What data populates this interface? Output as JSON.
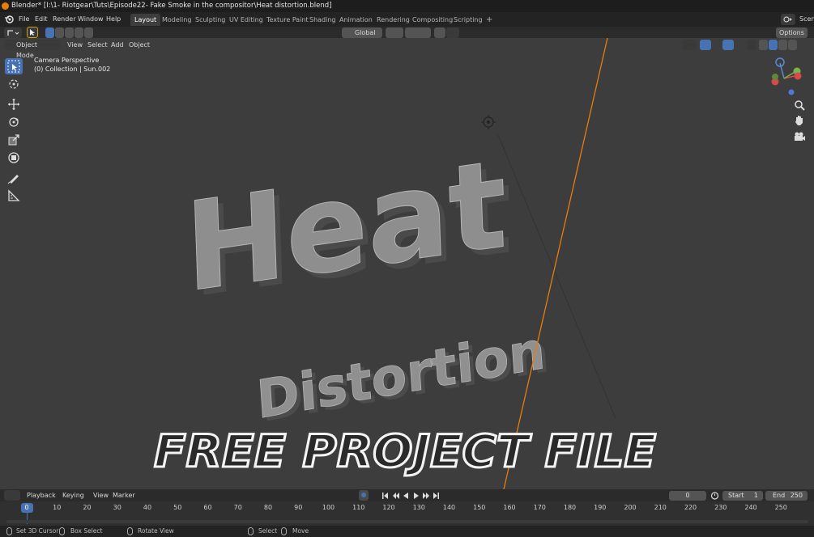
{
  "window": {
    "title": "Blender* [I:\\1- Riotgear\\Tuts\\Episode22- Fake Smoke in the compositor\\Heat distortion.blend]"
  },
  "menu": {
    "items": [
      "File",
      "Edit",
      "Render",
      "Window",
      "Help"
    ]
  },
  "workspaces": {
    "tabs": [
      "Layout",
      "Modeling",
      "Sculpting",
      "UV Editing",
      "Texture Paint",
      "Shading",
      "Animation",
      "Rendering",
      "Compositing",
      "Scripting"
    ],
    "active": "Layout",
    "add_label": "+"
  },
  "scene": {
    "label": "Scen"
  },
  "tool_header": {
    "transform_orientation": "Global",
    "options_label": "Options"
  },
  "viewport_header": {
    "mode": "Object Mode",
    "menus": [
      "View",
      "Select",
      "Add",
      "Object"
    ]
  },
  "viewport": {
    "camera_label": "Camera Perspective",
    "collection_label": "(0) Collection | Sun.002",
    "text_heat": "Heat",
    "text_distortion": "Distortion",
    "banner": "FREE PROJECT FILE",
    "accent_color": "#e87d0d"
  },
  "timeline": {
    "menus": [
      "Playback",
      "Keying",
      "View",
      "Marker"
    ],
    "current_frame": "0",
    "start_label": "Start",
    "start_value": "1",
    "end_label": "End",
    "end_value": "250",
    "ticks": [
      "0",
      "10",
      "20",
      "30",
      "40",
      "50",
      "60",
      "70",
      "80",
      "90",
      "100",
      "110",
      "120",
      "130",
      "140",
      "150",
      "160",
      "170",
      "180",
      "190",
      "200",
      "210",
      "220",
      "230",
      "240",
      "250"
    ],
    "playhead_color": "#4772b3"
  },
  "statusbar": {
    "set_cursor": "Set 3D Cursor",
    "box_select": "Box Select",
    "rotate_view": "Rotate View",
    "select": "Select",
    "move": "Move"
  },
  "icons": [
    "blender-logo-icon",
    "editor-type-icon",
    "select-box-icon",
    "cursor-icon",
    "move-icon",
    "rotate-icon",
    "scale-icon",
    "transform-icon",
    "annotate-icon",
    "measure-icon",
    "navigation-gizmo-icon",
    "zoom-icon",
    "pan-hand-icon",
    "camera-view-icon",
    "record-icon",
    "jump-start-icon",
    "prev-keyframe-icon",
    "play-reverse-icon",
    "play-icon",
    "next-keyframe-icon",
    "jump-end-icon",
    "stopwatch-icon",
    "mouse-icon"
  ]
}
